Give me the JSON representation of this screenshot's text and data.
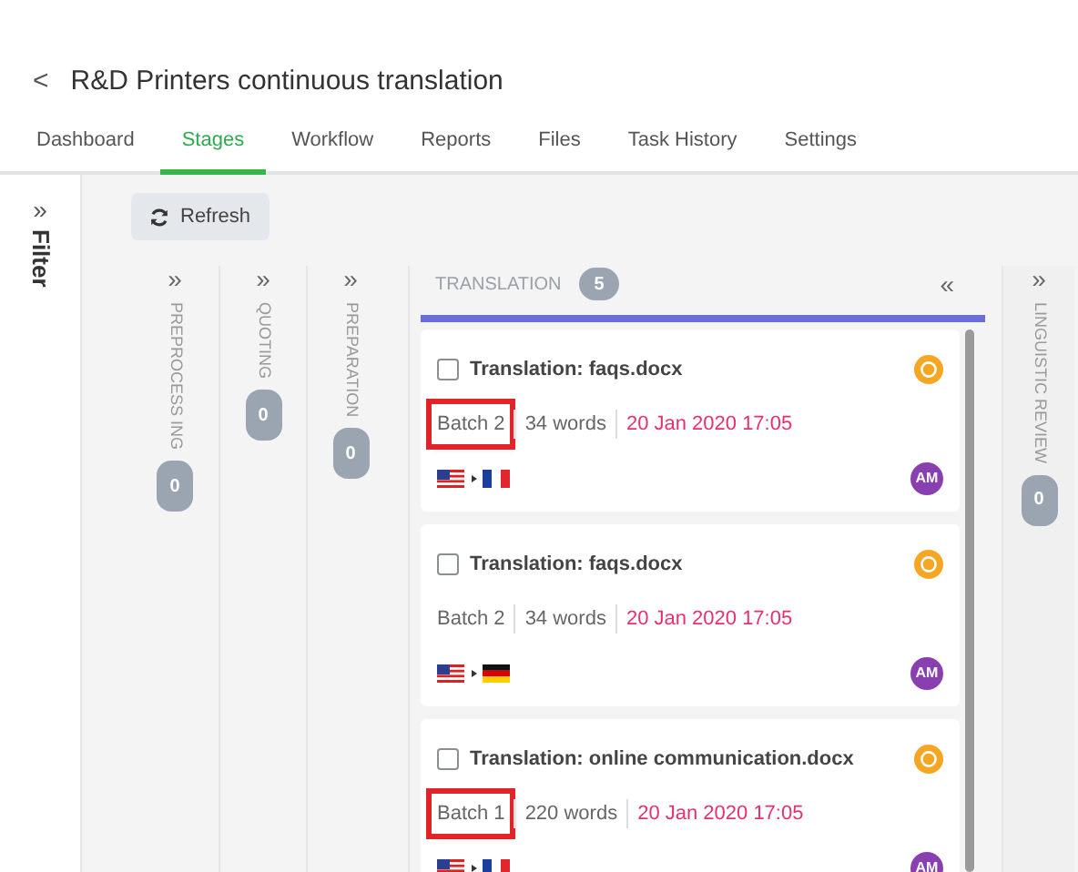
{
  "header": {
    "back": "<",
    "title": "R&D Printers continuous translation"
  },
  "tabs": [
    {
      "label": "Dashboard",
      "selected": false
    },
    {
      "label": "Stages",
      "selected": true
    },
    {
      "label": "Workflow",
      "selected": false
    },
    {
      "label": "Reports",
      "selected": false
    },
    {
      "label": "Files",
      "selected": false
    },
    {
      "label": "Task History",
      "selected": false
    },
    {
      "label": "Settings",
      "selected": false
    }
  ],
  "filter": {
    "expand": "»",
    "label": "Filter"
  },
  "refresh_button": "Refresh",
  "collapsed_stages": [
    {
      "expand": "»",
      "name": "PREPROCESS ING",
      "count": "0"
    },
    {
      "expand": "»",
      "name": "QUOTING",
      "count": "0"
    },
    {
      "expand": "»",
      "name": "PREPARATION",
      "count": "0"
    }
  ],
  "translation_stage": {
    "name": "TRANSLATION",
    "count": "5",
    "collapse": "«",
    "tasks": [
      {
        "checked": false,
        "title": "Translation: faqs.docx",
        "batch": "Batch 2",
        "highlighted": true,
        "words": "34 words",
        "due": "20 Jan 2020 17:05",
        "kind": "fr",
        "assignee": "AM"
      },
      {
        "checked": false,
        "title": "Translation: faqs.docx",
        "batch": "Batch 2",
        "highlighted": false,
        "words": "34 words",
        "due": "20 Jan 2020 17:05",
        "kind": "de",
        "assignee": "AM"
      },
      {
        "checked": false,
        "title": "Translation: online communication.docx",
        "batch": "Batch 1",
        "highlighted": true,
        "words": "220 words",
        "due": "20 Jan 2020 17:05",
        "kind": "fr",
        "assignee": "AM"
      }
    ]
  },
  "right_stage": {
    "expand": "»",
    "name": "LINGUISTIC REVIEW",
    "count": "0"
  }
}
